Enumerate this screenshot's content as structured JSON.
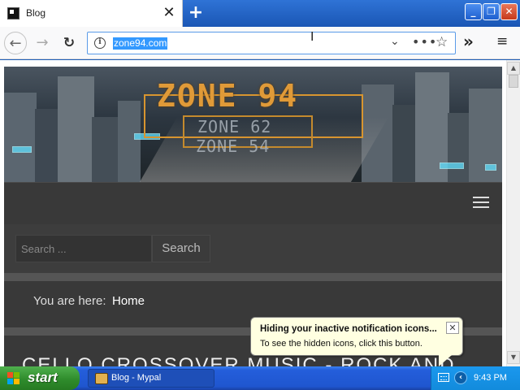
{
  "browser": {
    "tab_title": "Blog",
    "tab_close": "✕",
    "new_tab": "+",
    "url": "zone94.com",
    "buttons": {
      "back": "←",
      "forward": "→",
      "reload": "↻",
      "overflow": "»",
      "menu": "≡"
    },
    "window_buttons": {
      "min": "_",
      "max": "❐",
      "close": "✕"
    }
  },
  "site": {
    "logo_main": "ZONE 94",
    "logo_sub1": "ZONE 62",
    "logo_sub2": "ZONE 54",
    "search_placeholder": "Search ...",
    "search_button": "Search",
    "breadcrumb_label": "You are here:",
    "breadcrumb_home": "Home",
    "post_title": "CELLO CROSSOVER MUSIC - ROCK AND"
  },
  "notification": {
    "title": "Hiding your inactive notification icons...",
    "text": "To see the hidden icons, click this button.",
    "close": "✕"
  },
  "taskbar": {
    "start_label": "start",
    "task_label": "Blog - Mypal",
    "clock": "9:43 PM",
    "show_hidden": "‹"
  },
  "colors": {
    "taskbar_blue": "#245edb",
    "start_green": "#2f8c2c",
    "page_dark": "#393939",
    "logo_orange": "#e09a38"
  }
}
